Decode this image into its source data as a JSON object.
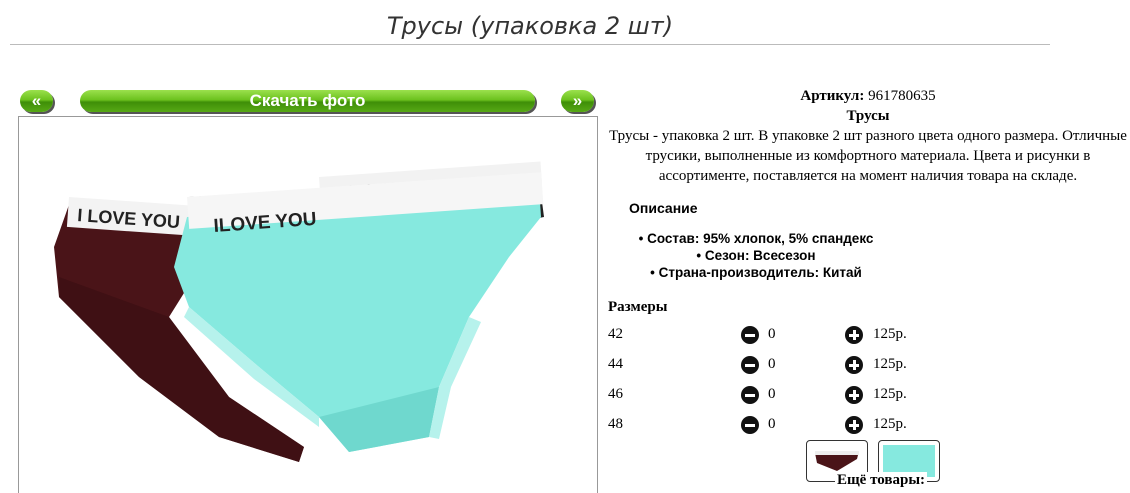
{
  "page": {
    "title": "Трусы (упаковка 2 шт)"
  },
  "gallery": {
    "prev_label": "«",
    "download_label": "Скачать фото",
    "next_label": "»",
    "photo_text": {
      "left_band": "I LOVE YOU",
      "right_band": "ILOVE YOU",
      "back_band": "ILOVE YOU"
    }
  },
  "product": {
    "sku_label": "Артикул:",
    "sku": "961780635",
    "name": "Трусы",
    "description": "Трусы - упаковка 2 шт. В упаковке 2 шт разного цвета одного размера. Отличные трусики, выполненные из комфортного материала. Цвета и рисунки в ассортименте, поставляется на момент наличия товара на складе.",
    "desc_heading": "Описание",
    "features": [
      "Состав: 95% хлопок, 5% спандекс",
      "Сезон: Всесезон",
      "Страна-производитель: Китай"
    ]
  },
  "sizes": {
    "heading": "Размеры",
    "rows": [
      {
        "size": "42",
        "qty": "0",
        "price": "125р."
      },
      {
        "size": "44",
        "qty": "0",
        "price": "125р."
      },
      {
        "size": "46",
        "qty": "0",
        "price": "125р."
      },
      {
        "size": "48",
        "qty": "0",
        "price": "125р."
      }
    ]
  },
  "more_label": "Ещё товары:",
  "colors": {
    "button_green": "#5db01a",
    "burgundy": "#4a1418",
    "mint": "#7fe5dc"
  }
}
